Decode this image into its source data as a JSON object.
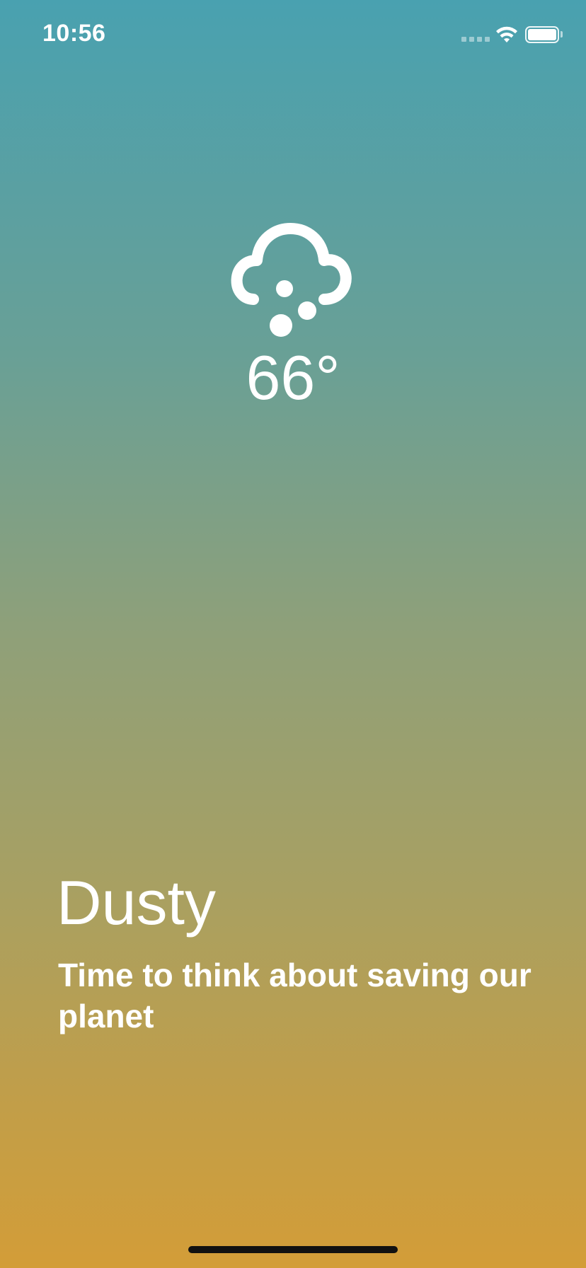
{
  "status_bar": {
    "time": "10:56"
  },
  "weather": {
    "icon": "cloud-dust-icon",
    "temperature": "66°",
    "condition": "Dusty",
    "message": "Time to think about saving our planet"
  },
  "colors": {
    "gradient_top": "#49a1b0",
    "gradient_bottom": "#d39d38",
    "text": "#ffffff",
    "home_indicator": "#111111"
  }
}
